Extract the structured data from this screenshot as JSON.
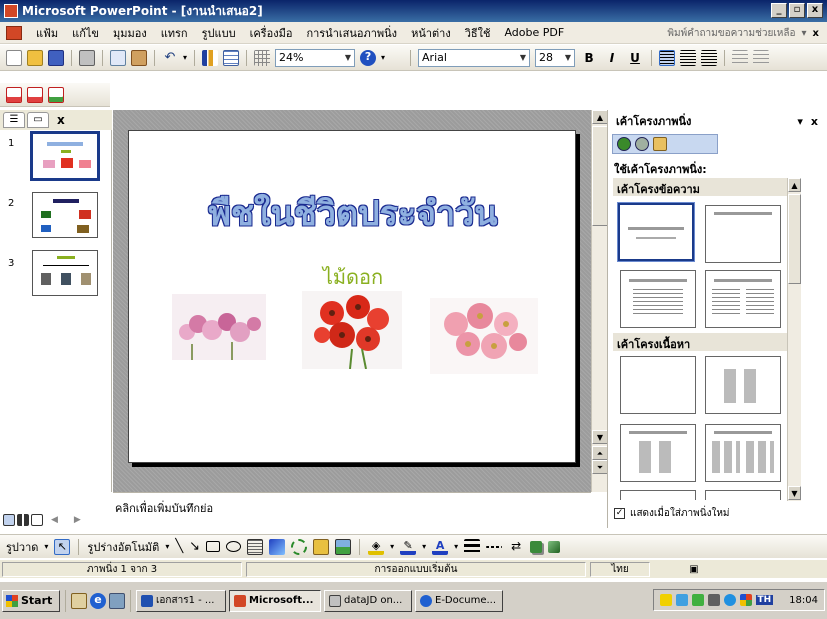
{
  "window": {
    "title": "Microsoft PowerPoint - [งานนำเสนอ2]",
    "min": "_",
    "max": "▫",
    "close": "x"
  },
  "menu": {
    "items": [
      "แฟ้ม",
      "แก้ไข",
      "มุมมอง",
      "แทรก",
      "รูปแบบ",
      "เครื่องมือ",
      "การนำเสนอภาพนิ่ง",
      "หน้าต่าง",
      "วิธีใช้",
      "Adobe PDF"
    ],
    "help_placeholder": "พิมพ์คำถามขอความช่วยเหลือ",
    "close": "x"
  },
  "toolbar": {
    "zoom": "24%",
    "font": "Arial",
    "font_size": "28",
    "bold": "B",
    "italic": "I",
    "underline": "U"
  },
  "outline": {
    "tab_close": "x",
    "slide_numbers": [
      "1",
      "2",
      "3"
    ]
  },
  "slide": {
    "title": "พืชในชีวิตประจำวัน",
    "subtitle": "ไม้ดอก"
  },
  "notes": {
    "placeholder": "คลิกเพื่อเพิ่มบันทึกย่อ"
  },
  "taskpane": {
    "title": "เค้าโครงภาพนิ่ง",
    "close": "x",
    "apply_label": "ใช้เค้าโครงภาพนิ่ง:",
    "section_text": "เค้าโครงข้อความ",
    "section_content": "เค้าโครงเนื้อหา",
    "show_check": "แสดงเมื่อใส่ภาพนิ่งใหม่"
  },
  "drawbar": {
    "draw_label": "รูปวาด",
    "autoshapes_label": "รูปร่างอัตโนมัติ"
  },
  "status": {
    "slide_count": "ภาพนิ่ง 1 จาก 3",
    "design": "การออกแบบเริ่มต้น",
    "language": "ไทย"
  },
  "taskbar": {
    "start": "Start",
    "buttons": [
      "เอกสาร1 - ...",
      "Microsoft...",
      "dataJD on...",
      "E-Docume..."
    ],
    "lang": "TH",
    "clock": "18:04"
  },
  "colors": {
    "title_fill": "#8fb0e0",
    "title_outline": "#1a2a90",
    "subtitle": "#8ab020",
    "accent": "#0a246a"
  }
}
